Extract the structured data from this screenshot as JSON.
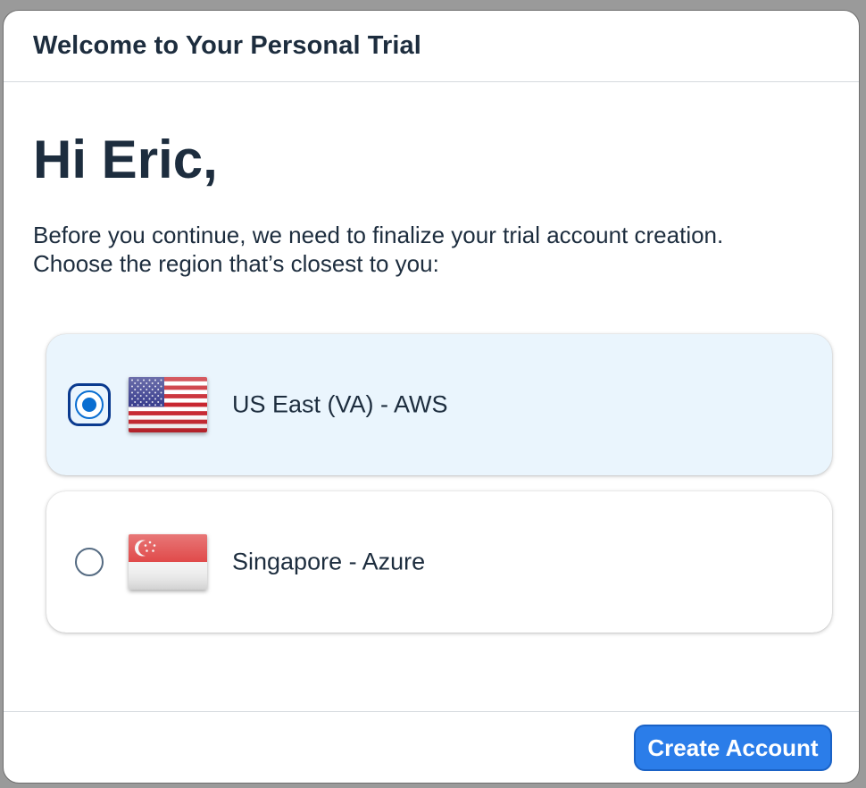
{
  "dialog": {
    "title": "Welcome to Your Personal Trial"
  },
  "content": {
    "greeting": "Hi Eric,",
    "intro_line_1": "Before you continue, we need to finalize your trial account creation.",
    "intro_line_2": "Choose the region that’s closest to you:"
  },
  "regions": [
    {
      "label": "US East (VA) - AWS",
      "flag": "us-flag-icon",
      "selected": true
    },
    {
      "label": "Singapore - Azure",
      "flag": "singapore-flag-icon",
      "selected": false
    }
  ],
  "footer": {
    "create_label": "Create Account"
  },
  "colors": {
    "accent": "#0a6ed1",
    "selected_background": "#eaf5fd",
    "text": "#1d2d3e",
    "button": "#2b7de9"
  }
}
